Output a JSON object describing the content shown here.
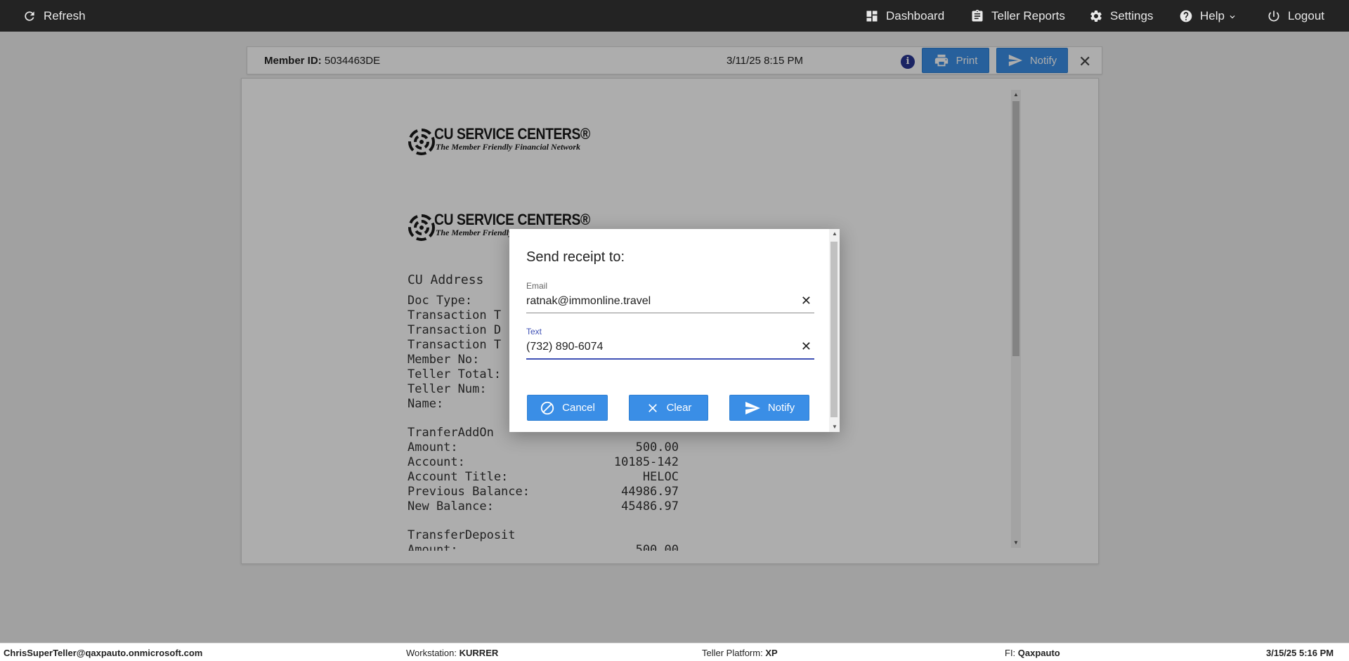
{
  "topbar": {
    "refresh": "Refresh",
    "dashboard": "Dashboard",
    "teller_reports": "Teller Reports",
    "settings": "Settings",
    "help": "Help",
    "logout": "Logout"
  },
  "receipt_header": {
    "member_id_label": "Member ID:",
    "member_id": "5034463DE",
    "datetime": "3/11/25 8:15 PM",
    "print": "Print",
    "notify": "Notify"
  },
  "receipt": {
    "logo_brand": "CU SERVICE CENTERS®",
    "logo_tagline": "The Member Friendly Financial Network",
    "lines": [
      "CU Address",
      "Doc Type:",
      "Transaction T",
      "Transaction D",
      "Transaction T",
      "Member No:",
      "Teller Total:",
      "Teller Num:",
      "Name:"
    ],
    "section1_title": "TranferAddOn",
    "section1": [
      {
        "label": "Amount:",
        "value": "500.00"
      },
      {
        "label": "Account:",
        "value": "10185-142"
      },
      {
        "label": "Account Title:",
        "value": "HELOC"
      },
      {
        "label": "Previous Balance:",
        "value": "44986.97"
      },
      {
        "label": "New Balance:",
        "value": "45486.97"
      }
    ],
    "section2_title": "TransferDeposit",
    "section2": [
      {
        "label": "Amount:",
        "value": "500.00"
      }
    ]
  },
  "modal": {
    "title": "Send receipt to:",
    "email_label": "Email",
    "email_value": "ratnak@immonline.travel",
    "text_label": "Text",
    "text_value": "(732) 890-6074",
    "cancel": "Cancel",
    "clear": "Clear",
    "notify": "Notify"
  },
  "statusbar": {
    "user": "ChrisSuperTeller@qaxpauto.onmicrosoft.com",
    "workstation_label": "Workstation:",
    "workstation": "KURRER",
    "platform_label": "Teller Platform:",
    "platform": "XP",
    "fi_label": "FI:",
    "fi": "Qaxpauto",
    "datetime": "3/15/25 5:16 PM"
  },
  "colors": {
    "topbar": "#232323",
    "button": "#3a8ee6",
    "focus": "#3f51b5",
    "info_icon": "#283593"
  }
}
